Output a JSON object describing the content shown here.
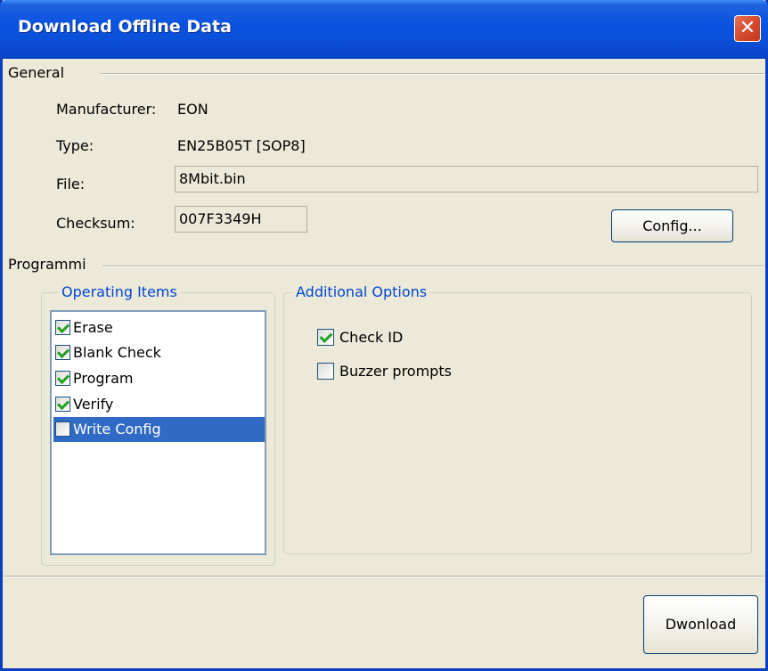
{
  "window": {
    "title": "Download Offline Data",
    "close_icon": "close-x-icon"
  },
  "general": {
    "legend": "General",
    "manufacturer_label": "Manufacturer:",
    "manufacturer_value": "EON",
    "type_label": "Type:",
    "type_value": "EN25B05T [SOP8]",
    "file_label": "File:",
    "file_value": "8Mbit.bin",
    "checksum_label": "Checksum:",
    "checksum_value": "007F3349H",
    "config_button": "Config..."
  },
  "programming": {
    "legend": "Programmi",
    "operating_items": {
      "legend": "Operating Items",
      "items": [
        {
          "label": "Erase",
          "checked": true,
          "selected": false
        },
        {
          "label": "Blank Check",
          "checked": true,
          "selected": false
        },
        {
          "label": "Program",
          "checked": true,
          "selected": false
        },
        {
          "label": "Verify",
          "checked": true,
          "selected": false
        },
        {
          "label": "Write Config",
          "checked": false,
          "selected": true
        }
      ]
    },
    "additional_options": {
      "legend": "Additional Options",
      "options": [
        {
          "label": "Check ID",
          "checked": true
        },
        {
          "label": "Buzzer prompts",
          "checked": false
        }
      ]
    }
  },
  "footer": {
    "download_button": "Dwonload"
  },
  "colors": {
    "titlebar": "#0a53e0",
    "selection": "#316ac5",
    "legend_text": "#0046d5",
    "check": "#21a121",
    "close_button": "#d74a2e"
  }
}
